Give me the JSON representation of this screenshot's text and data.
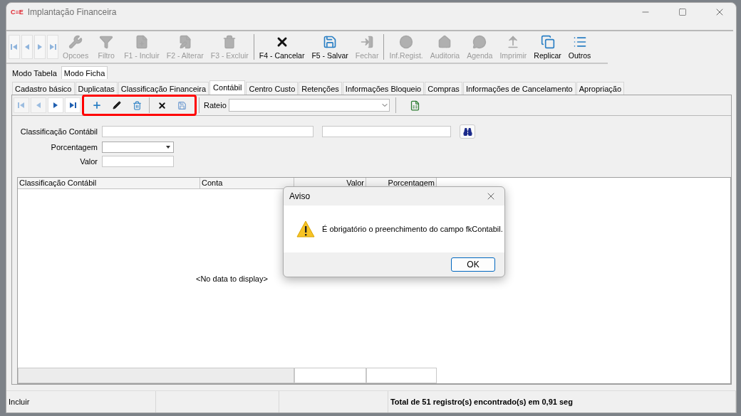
{
  "window": {
    "title": "Implantação Financeira",
    "logo": "C≡E"
  },
  "toolbar": {
    "nav": [
      {
        "enabled": false
      },
      {
        "enabled": false
      },
      {
        "enabled": false
      },
      {
        "enabled": false
      }
    ],
    "groups": [
      [
        {
          "label": "Opcoes",
          "enabled": false
        },
        {
          "label": "Filtro",
          "enabled": false
        },
        {
          "label": "F1 - Incluir",
          "enabled": false
        },
        {
          "label": "F2 - Alterar",
          "enabled": false
        },
        {
          "label": "F3 - Excluir",
          "enabled": false
        }
      ],
      [
        {
          "label": "F4 - Cancelar",
          "enabled": true
        },
        {
          "label": "F5 - Salvar",
          "enabled": true
        },
        {
          "label": "Fechar",
          "enabled": false
        }
      ],
      [
        {
          "label": "Inf.Regist.",
          "enabled": false
        },
        {
          "label": "Auditoria",
          "enabled": false
        },
        {
          "label": "Agenda",
          "enabled": false
        },
        {
          "label": "Imprimir",
          "enabled": false
        },
        {
          "label": "Replicar",
          "enabled": true
        },
        {
          "label": "Outros",
          "enabled": true
        }
      ]
    ]
  },
  "mode_tabs": [
    {
      "label": "Modo Tabela",
      "selected": false
    },
    {
      "label": "Modo Ficha",
      "selected": true
    }
  ],
  "tabs": [
    {
      "label": "Cadastro básico",
      "selected": false
    },
    {
      "label": "Duplicatas",
      "selected": false
    },
    {
      "label": "Classificação Financeira",
      "selected": false
    },
    {
      "label": "Contábil",
      "selected": true
    },
    {
      "label": "Centro Custo",
      "selected": false
    },
    {
      "label": "Retenções",
      "selected": false
    },
    {
      "label": "Informações Bloqueio",
      "selected": false
    },
    {
      "label": "Compras",
      "selected": false
    },
    {
      "label": "Informações de Cancelamento",
      "selected": false
    },
    {
      "label": "Apropriação",
      "selected": false
    }
  ],
  "sub_toolbar": {
    "nav": [
      {
        "enabled": false
      },
      {
        "enabled": false
      },
      {
        "enabled": true
      },
      {
        "enabled": true
      }
    ],
    "edit_group_highlighted": true,
    "rateio_label": "Rateio"
  },
  "form": {
    "fields": [
      {
        "label": "Classificação Contábil",
        "kind": "lookup"
      },
      {
        "label": "Porcentagem",
        "kind": "dropdown"
      },
      {
        "label": "Valor",
        "kind": "text"
      }
    ]
  },
  "grid": {
    "columns": [
      "Classificação Contábil",
      "Conta",
      "Valor",
      "Porcentagem"
    ],
    "empty_text": "<No data to display>"
  },
  "dialog": {
    "title": "Aviso",
    "message": "É obrigatório o preenchimento do campo fkContabil.",
    "button": "OK"
  },
  "status_bar": {
    "left": "Incluir",
    "right": "Total de 51 registro(s) encontrado(s) em 0,91 seg"
  }
}
